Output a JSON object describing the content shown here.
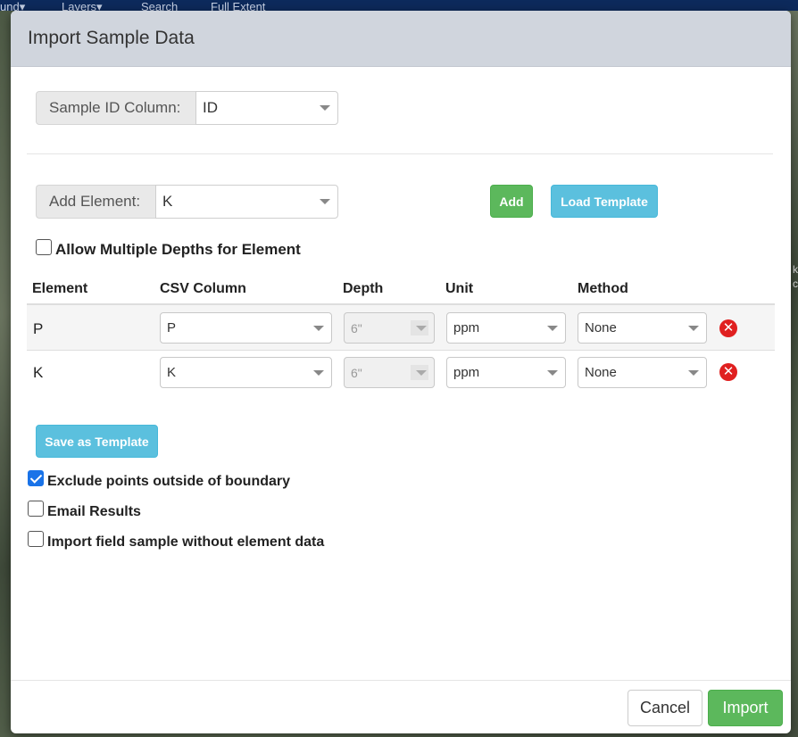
{
  "background": {
    "nav": [
      "und▾",
      "Layers▾",
      "Search",
      "Full Extent"
    ],
    "edge_text": [
      "k",
      "c"
    ]
  },
  "dialog": {
    "title": "Import Sample Data",
    "sample_id": {
      "label": "Sample ID Column:",
      "value": "ID"
    },
    "add_element": {
      "label": "Add Element:",
      "value": "K"
    },
    "add_button": "Add",
    "load_template_button": "Load Template",
    "allow_multiple_depths": {
      "label": "Allow Multiple Depths for Element",
      "checked": false
    },
    "table": {
      "headers": [
        "Element",
        "CSV Column",
        "Depth",
        "Unit",
        "Method"
      ],
      "rows": [
        {
          "element": "P",
          "csv_column": "P",
          "depth": "6\"",
          "unit": "ppm",
          "method": "None"
        },
        {
          "element": "K",
          "csv_column": "K",
          "depth": "6\"",
          "unit": "ppm",
          "method": "None"
        }
      ]
    },
    "save_template_button": "Save as Template",
    "options": [
      {
        "label": "Exclude points outside of boundary",
        "checked": true
      },
      {
        "label": "Email Results",
        "checked": false
      },
      {
        "label": "Import field sample without element data",
        "checked": false
      }
    ],
    "cancel_button": "Cancel",
    "import_button": "Import"
  },
  "colors": {
    "header_bg": "#d0d5dd",
    "success": "#5cb85c",
    "info": "#5bc0de",
    "danger": "#e02020",
    "checkbox_checked": "#1a73e8"
  },
  "icons": {
    "delete": "times-circle-icon",
    "dropdown": "chevron-down-icon"
  }
}
